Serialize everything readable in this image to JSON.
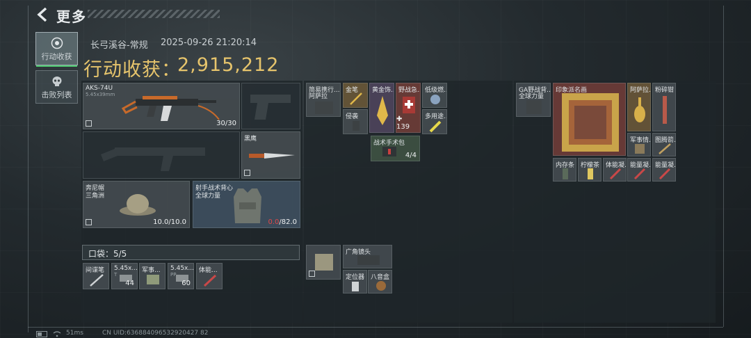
{
  "header": {
    "title": "更多"
  },
  "nav": {
    "tab_loot": "行动收获",
    "tab_kills": "击败列表"
  },
  "info": {
    "map_mode": "长弓溪谷-常规",
    "datetime": "2025-09-26 21:20:14",
    "haul_label": "行动收获：",
    "haul_value": "2,915,212"
  },
  "equipment": {
    "primary": {
      "name": "AKS-74U",
      "caliber": "5.45x39mm",
      "ammo": "30/30"
    },
    "melee": {
      "name": "黑鹰"
    },
    "helmet": {
      "name_line1": "奔尼帽",
      "name_line2": "三角洲",
      "durability": "10.0/10.0"
    },
    "vest": {
      "name_line1": "射手战术背心",
      "name_line2": "全球力量",
      "durability_current": "0.0",
      "durability_max": "/82.0"
    }
  },
  "pocket": {
    "label": "口袋：5/5",
    "items": [
      {
        "name": "间谍笔",
        "count": ""
      },
      {
        "name": "5.45x...",
        "sub": "T",
        "count": "44"
      },
      {
        "name": "军事...",
        "count": ""
      },
      {
        "name": "5.45x...",
        "sub": "PP",
        "count": "60"
      },
      {
        "name": "体能...",
        "count": ""
      }
    ]
  },
  "chest_rig": {
    "header": {
      "name_line1": "简易携行...",
      "name_line2": "阿萨拉"
    },
    "items": [
      {
        "name": "金笔",
        "count": ""
      },
      {
        "name": "黄金饰...",
        "count": ""
      },
      {
        "name": "野战急...",
        "count": "139"
      },
      {
        "name": "低级燃...",
        "count": ""
      },
      {
        "name": "侵袭",
        "count": ""
      },
      {
        "name": "多用途...",
        "count": ""
      },
      {
        "name": "战术手术包",
        "count": "4/4"
      }
    ]
  },
  "case": {
    "items": [
      {
        "name": "广角镜头",
        "count": ""
      },
      {
        "name": "定位器",
        "count": ""
      },
      {
        "name": "八音盒",
        "count": ""
      }
    ]
  },
  "backpack": {
    "header": {
      "name_line1": "GA野战背...",
      "name_line2": "全球力量"
    },
    "items": [
      {
        "name": "印象派名画"
      },
      {
        "name": "阿萨拉..."
      },
      {
        "name": "粉碎钳"
      },
      {
        "name": "军事情..."
      },
      {
        "name": "图腾箭..."
      },
      {
        "name": "内存条"
      },
      {
        "name": "柠檬茶"
      },
      {
        "name": "体能凝..."
      },
      {
        "name": "能量凝..."
      },
      {
        "name": "能量凝..."
      }
    ]
  },
  "footer": {
    "ping": "51ms",
    "uid": "CN UID:636884096532920427 82"
  },
  "colors": {
    "haul": "#e6c46c",
    "accent_green": "#4ecb71",
    "durability_red": "#e04848"
  }
}
